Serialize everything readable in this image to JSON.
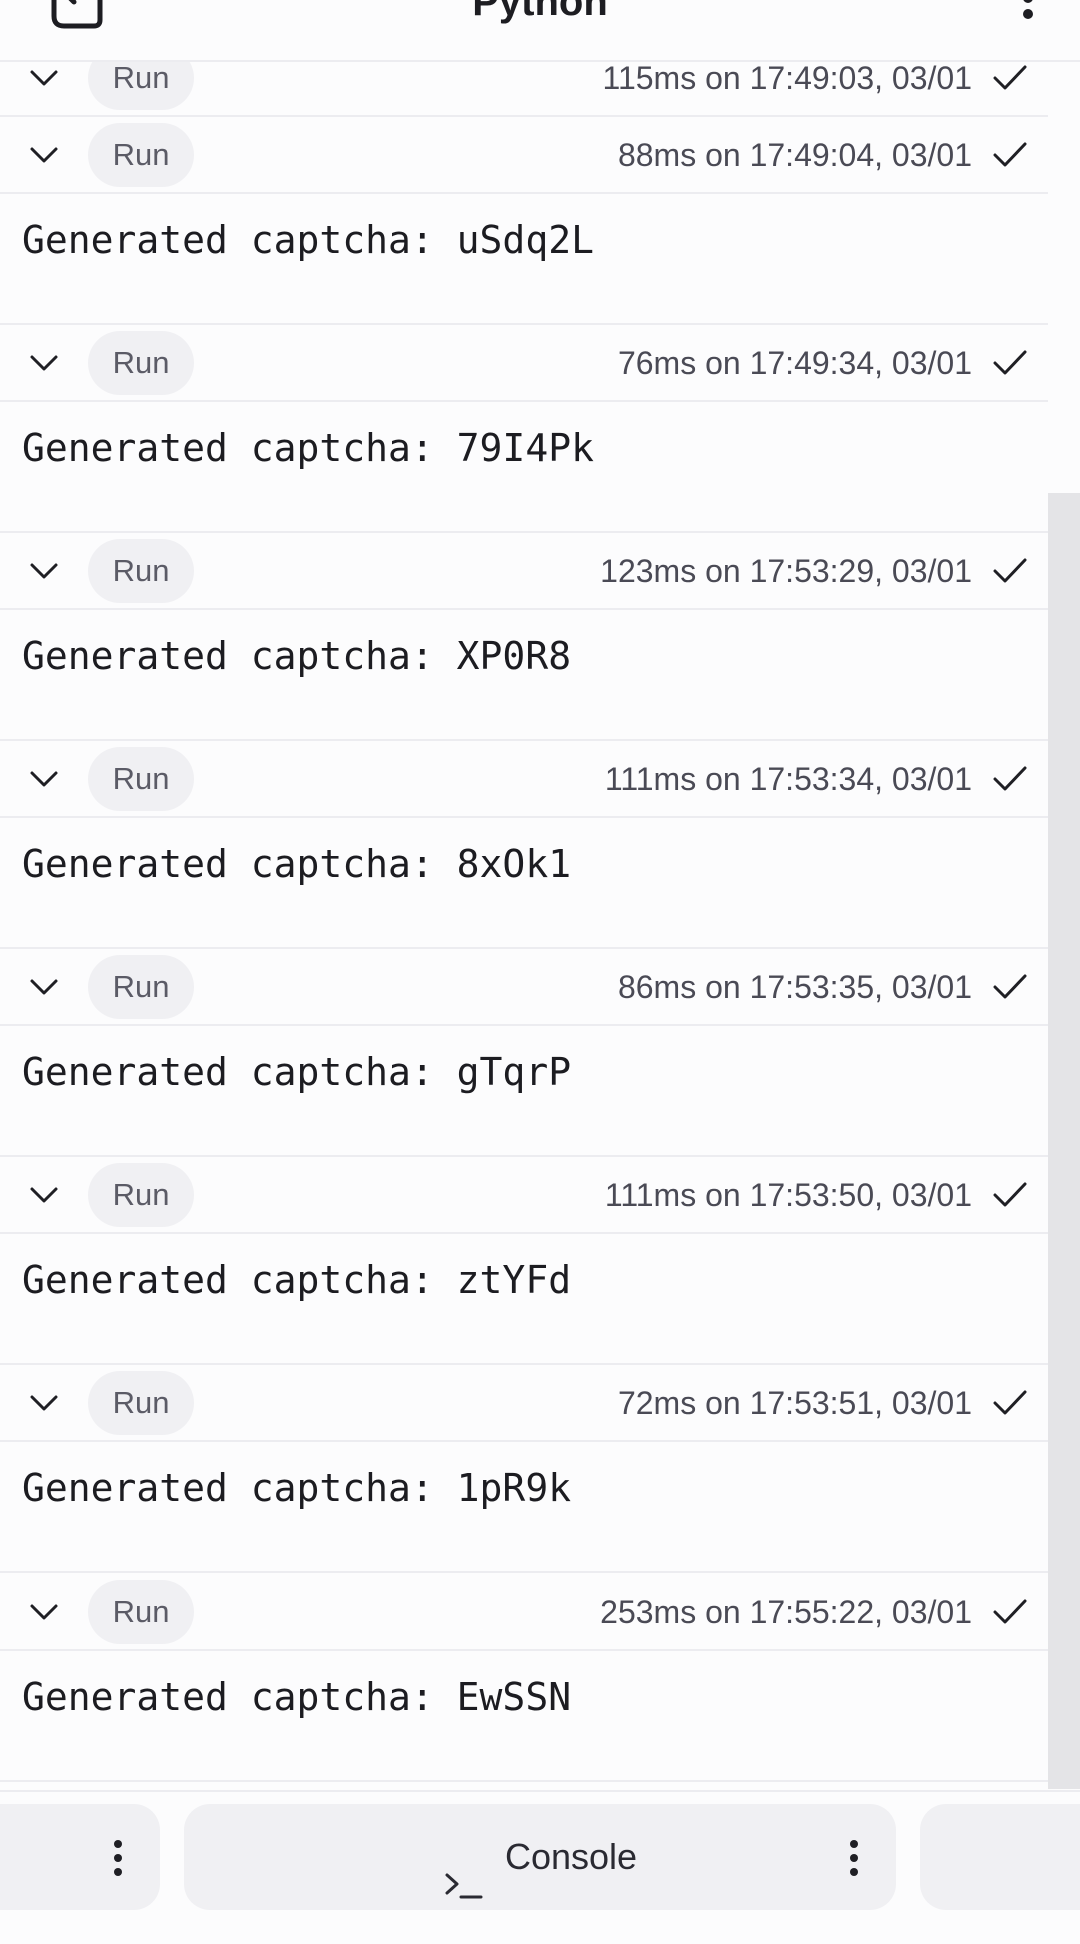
{
  "header": {
    "title": "Python",
    "back_icon": "exit-arrow-icon",
    "menu_icon": "kebab-vertical-icon"
  },
  "runs": [
    {
      "run_label": "Run",
      "meta": "115ms on 17:49:03, 03/01",
      "output": ""
    },
    {
      "run_label": "Run",
      "meta": "88ms on 17:49:04, 03/01",
      "output": "Generated captcha: uSdq2L"
    },
    {
      "run_label": "Run",
      "meta": "76ms on 17:49:34, 03/01",
      "output": "Generated captcha: 79I4Pk"
    },
    {
      "run_label": "Run",
      "meta": "123ms on 17:53:29, 03/01",
      "output": "Generated captcha: XP0R8"
    },
    {
      "run_label": "Run",
      "meta": "111ms on 17:53:34, 03/01",
      "output": "Generated captcha: 8xOk1"
    },
    {
      "run_label": "Run",
      "meta": "86ms on 17:53:35, 03/01",
      "output": "Generated captcha: gTqrP"
    },
    {
      "run_label": "Run",
      "meta": "111ms on 17:53:50, 03/01",
      "output": "Generated captcha: ztYFd"
    },
    {
      "run_label": "Run",
      "meta": "72ms on 17:53:51, 03/01",
      "output": "Generated captcha: 1pR9k"
    },
    {
      "run_label": "Run",
      "meta": "253ms on 17:55:22, 03/01",
      "output": "Generated captcha: EwSSN"
    }
  ],
  "bottom_bar": {
    "console_label": "Console",
    "console_icon": "terminal-prompt-icon"
  },
  "colors": {
    "background": "#fcfcfd",
    "pill": "#f0f0f3",
    "divider": "#ececf0",
    "scroll_track": "#e4e4e7"
  }
}
